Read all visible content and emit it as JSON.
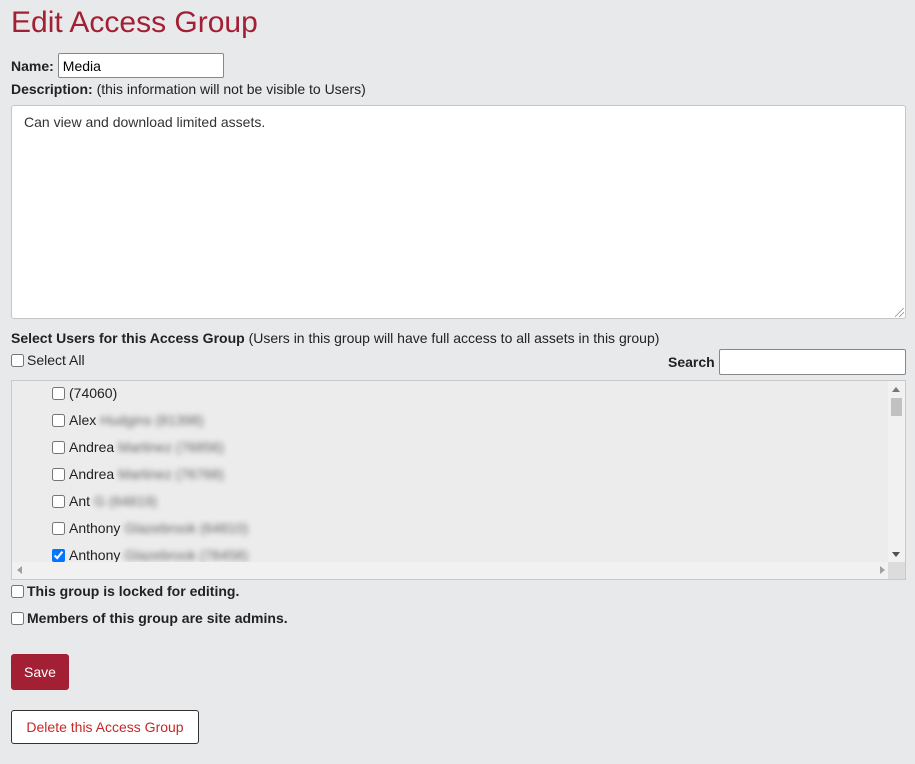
{
  "page": {
    "title": "Edit Access Group"
  },
  "name": {
    "label": "Name:",
    "value": "Media"
  },
  "description": {
    "label": "Description:",
    "hint": "(this information will not be visible to Users)",
    "value": "Can view and download limited assets."
  },
  "users": {
    "label": "Select Users for this Access Group",
    "hint": "(Users in this group will have full access to all assets in this group)",
    "select_all_label": "Select All",
    "search_label": "Search",
    "search_value": "",
    "items": [
      {
        "first": "",
        "rest": "(74060)",
        "checked": false,
        "rest_blurred": false
      },
      {
        "first": "Alex",
        "rest": "Hudgins (81398)",
        "checked": false,
        "rest_blurred": true
      },
      {
        "first": "Andrea",
        "rest": "Martinez (76856)",
        "checked": false,
        "rest_blurred": true
      },
      {
        "first": "Andrea",
        "rest": "Martinez (76768)",
        "checked": false,
        "rest_blurred": true
      },
      {
        "first": "Ant",
        "rest": "G (64819)",
        "checked": false,
        "rest_blurred": true
      },
      {
        "first": "Anthony",
        "rest": "Glazebrook (64810)",
        "checked": false,
        "rest_blurred": true
      },
      {
        "first": "Anthony",
        "rest": "Glazebrook (78458)",
        "checked": true,
        "rest_blurred": true
      }
    ]
  },
  "options": {
    "locked_label": "This group is locked for editing.",
    "locked_checked": false,
    "admins_label": "Members of this group are site admins.",
    "admins_checked": false
  },
  "actions": {
    "save_label": "Save",
    "delete_label": "Delete this Access Group"
  },
  "colors": {
    "brand": "#a31f34",
    "danger_text": "#c62828",
    "background": "#e8e9eb"
  }
}
